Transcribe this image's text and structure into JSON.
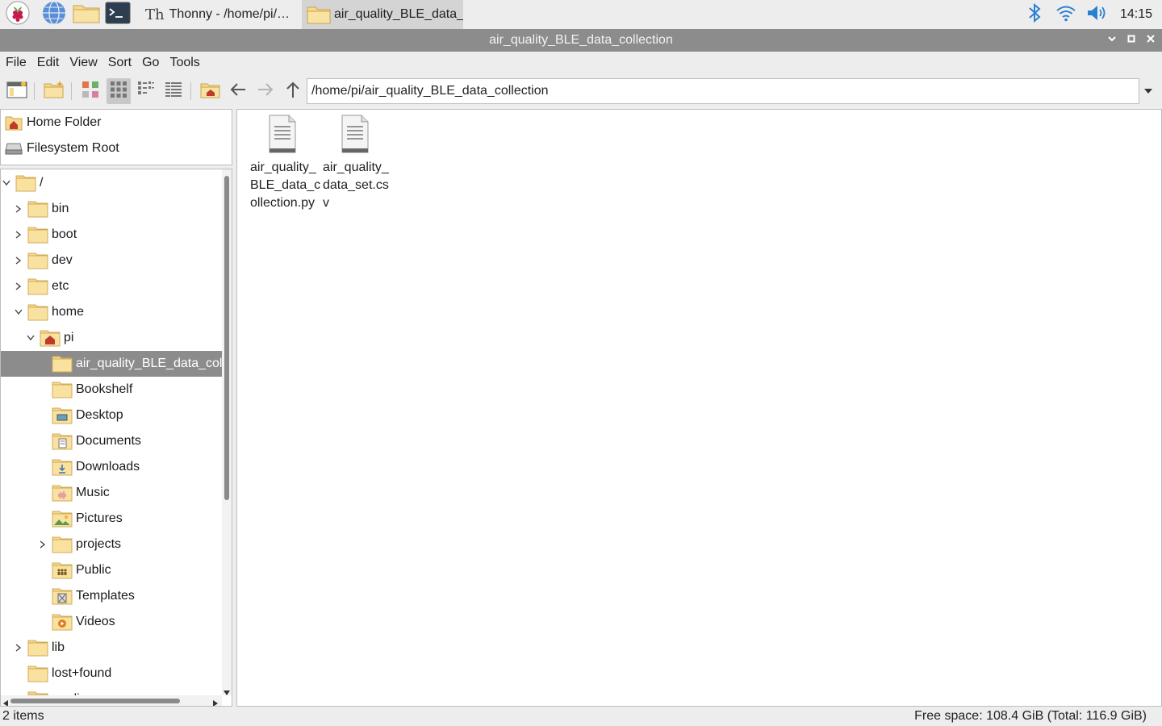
{
  "taskbar": {
    "launchers": [
      {
        "name": "raspberry-menu"
      },
      {
        "name": "web-browser"
      },
      {
        "name": "file-manager"
      },
      {
        "name": "terminal"
      }
    ],
    "tasks": [
      {
        "label": "Thonny  -  /home/pi/…"
      },
      {
        "label": "air_quality_BLE_data_…"
      }
    ],
    "clock": "14:15"
  },
  "window": {
    "title": "air_quality_BLE_data_collection"
  },
  "menu": [
    "File",
    "Edit",
    "View",
    "Sort",
    "Go",
    "Tools"
  ],
  "path": "/home/pi/air_quality_BLE_data_collection",
  "places": [
    {
      "label": "Home Folder",
      "icon": "home-folder-icon"
    },
    {
      "label": "Filesystem Root",
      "icon": "drive-icon"
    }
  ],
  "tree": [
    {
      "label": "/",
      "depth": 0,
      "expander": "open",
      "icon": "folder"
    },
    {
      "label": "bin",
      "depth": 1,
      "expander": "closed",
      "icon": "folder"
    },
    {
      "label": "boot",
      "depth": 1,
      "expander": "closed",
      "icon": "folder"
    },
    {
      "label": "dev",
      "depth": 1,
      "expander": "closed",
      "icon": "folder"
    },
    {
      "label": "etc",
      "depth": 1,
      "expander": "closed",
      "icon": "folder"
    },
    {
      "label": "home",
      "depth": 1,
      "expander": "open",
      "icon": "folder"
    },
    {
      "label": "pi",
      "depth": 2,
      "expander": "open",
      "icon": "home"
    },
    {
      "label": "air_quality_BLE_data_collection",
      "depth": 3,
      "expander": "none",
      "icon": "folder",
      "selected": true
    },
    {
      "label": "Bookshelf",
      "depth": 3,
      "expander": "none",
      "icon": "folder"
    },
    {
      "label": "Desktop",
      "depth": 3,
      "expander": "none",
      "icon": "desktop"
    },
    {
      "label": "Documents",
      "depth": 3,
      "expander": "none",
      "icon": "documents"
    },
    {
      "label": "Downloads",
      "depth": 3,
      "expander": "none",
      "icon": "downloads"
    },
    {
      "label": "Music",
      "depth": 3,
      "expander": "none",
      "icon": "music"
    },
    {
      "label": "Pictures",
      "depth": 3,
      "expander": "none",
      "icon": "pictures"
    },
    {
      "label": "projects",
      "depth": 3,
      "expander": "closed",
      "icon": "folder"
    },
    {
      "label": "Public",
      "depth": 3,
      "expander": "none",
      "icon": "public"
    },
    {
      "label": "Templates",
      "depth": 3,
      "expander": "none",
      "icon": "templates"
    },
    {
      "label": "Videos",
      "depth": 3,
      "expander": "none",
      "icon": "videos"
    },
    {
      "label": "lib",
      "depth": 1,
      "expander": "closed",
      "icon": "folder"
    },
    {
      "label": "lost+found",
      "depth": 1,
      "expander": "none",
      "icon": "folder"
    },
    {
      "label": "media",
      "depth": 1,
      "expander": "closed",
      "icon": "folder"
    }
  ],
  "files": [
    {
      "name": "air_quality_BLE_data_collection.py"
    },
    {
      "name": "air_quality_data_set.csv"
    }
  ],
  "status": {
    "items": "2 items",
    "free_space": "Free space: 108.4 GiB (Total: 116.9 GiB)"
  },
  "colors": {
    "folder": "#f6d98a",
    "folder_edge": "#d8b35a",
    "selection": "#8c8c8c",
    "titlebar": "#8c8c8c",
    "tray_blue": "#2b7fd1"
  }
}
